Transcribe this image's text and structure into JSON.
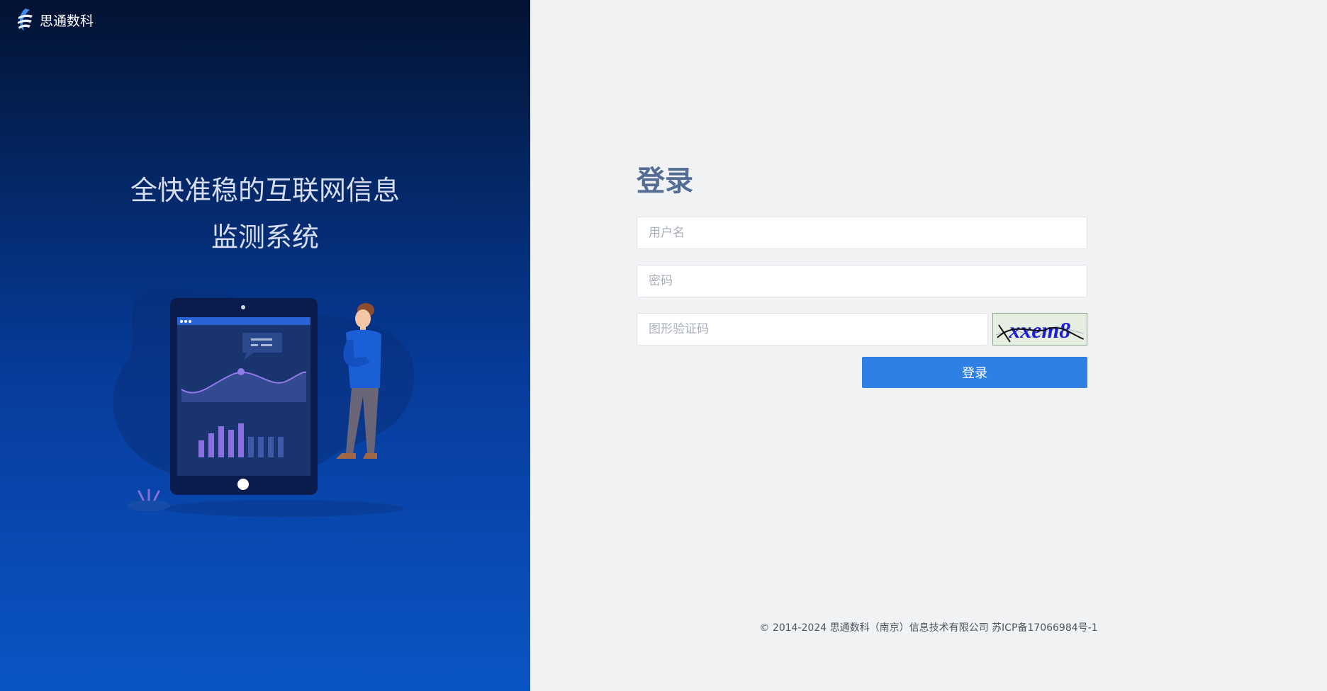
{
  "brand": {
    "name": "思通数科",
    "logo_icon": "brand-logo-icon"
  },
  "slogan": {
    "line1": "全快准稳的互联网信息",
    "line2": "监测系统"
  },
  "login": {
    "title": "登录",
    "username_placeholder": "用户名",
    "password_placeholder": "密码",
    "captcha_placeholder": "图形验证码",
    "captcha_text": "xxem8",
    "submit_label": "登录"
  },
  "footer": {
    "text": "© 2014-2024 思通数科（南京）信息技术有限公司 苏ICP备17066984号-1"
  },
  "colors": {
    "accent": "#2e80e4",
    "title": "#556c93",
    "panel_bg": "#f1f2f4"
  }
}
